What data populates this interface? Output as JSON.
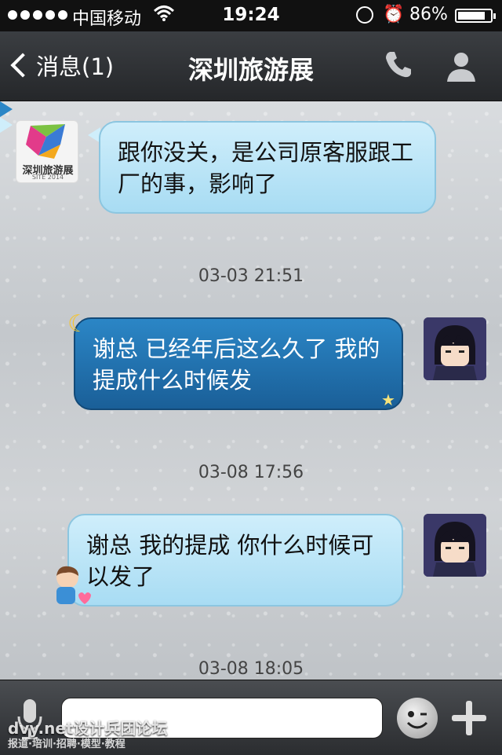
{
  "status_bar": {
    "carrier": "中国移动",
    "time": "19:24",
    "battery_percent": "86%",
    "battery_level": 0.86
  },
  "nav": {
    "back_label": "消息(1)",
    "title": "深圳旅游展",
    "icons": [
      "back-chevron-icon",
      "phone-icon",
      "person-icon"
    ]
  },
  "contact_logo": {
    "name": "深圳旅游展",
    "sub": "SITE 2014"
  },
  "messages": [
    {
      "side": "left",
      "text": "跟你没关，是公司原客服跟工厂的事，影响了"
    },
    {
      "side": "right",
      "text": "谢总 已经年后这么久了 我的提成什么时候发"
    },
    {
      "side": "right",
      "text": "谢总  我的提成 你什么时候可以发了"
    }
  ],
  "timestamps": [
    "03-03 21:51",
    "03-08 17:56",
    "03-08 18:05"
  ],
  "input_bar": {
    "icons": [
      "microphone-icon",
      "emoji-icon",
      "plus-icon"
    ],
    "watermark": "dvy.net设计兵团论坛",
    "watermark_sub": "报道·培训·招聘·模型·教程"
  },
  "colors": {
    "light_bubble": "#a8dcf3",
    "dark_bubble": "#1a5f98",
    "nav_bg": "#2e3135"
  }
}
